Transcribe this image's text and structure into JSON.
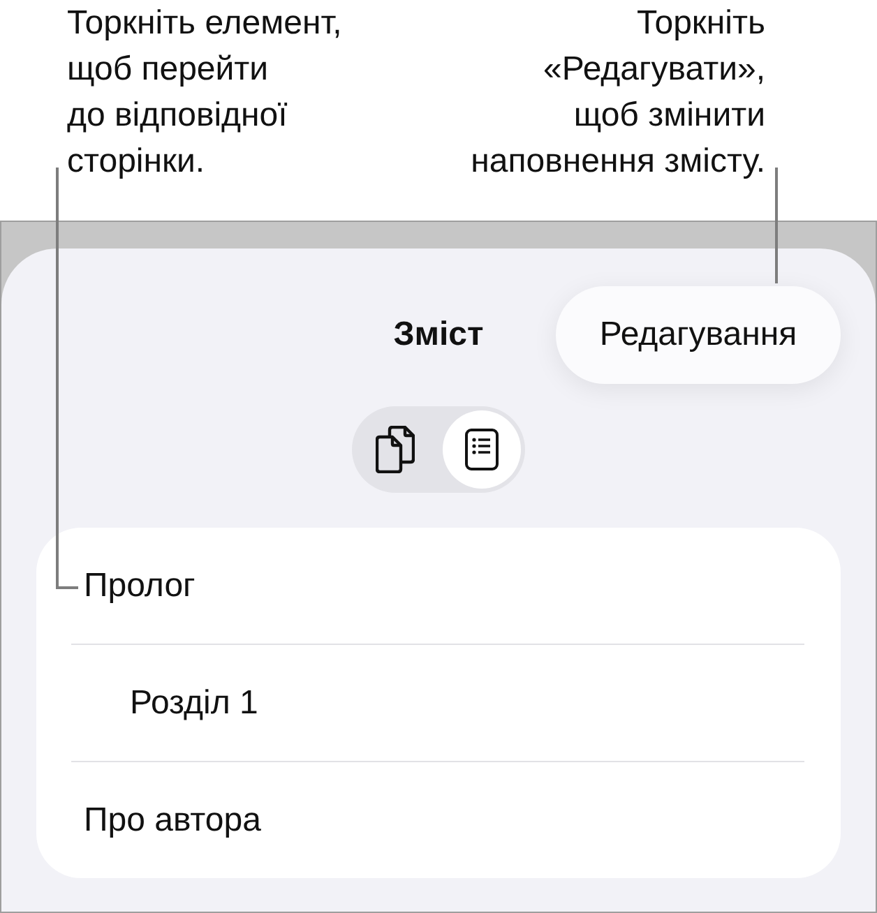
{
  "callouts": [
    {
      "kind": "left",
      "text": "Торкніть елемент,\nщоб перейти\nдо відповідної\nсторінки."
    },
    {
      "kind": "right",
      "text": "Торкніть\n«Редагувати»,\nщоб змінити\nнаповнення змісту."
    }
  ],
  "sheet": {
    "title": "Зміст",
    "edit_button": "Редагування",
    "view_switch": [
      {
        "kind": "pages",
        "selected": false
      },
      {
        "kind": "contents",
        "selected": true
      }
    ]
  },
  "contents": [
    {
      "title": "Пролог",
      "children": [
        {
          "title": "Розділ 1"
        }
      ]
    },
    {
      "title": "Про автора"
    }
  ]
}
